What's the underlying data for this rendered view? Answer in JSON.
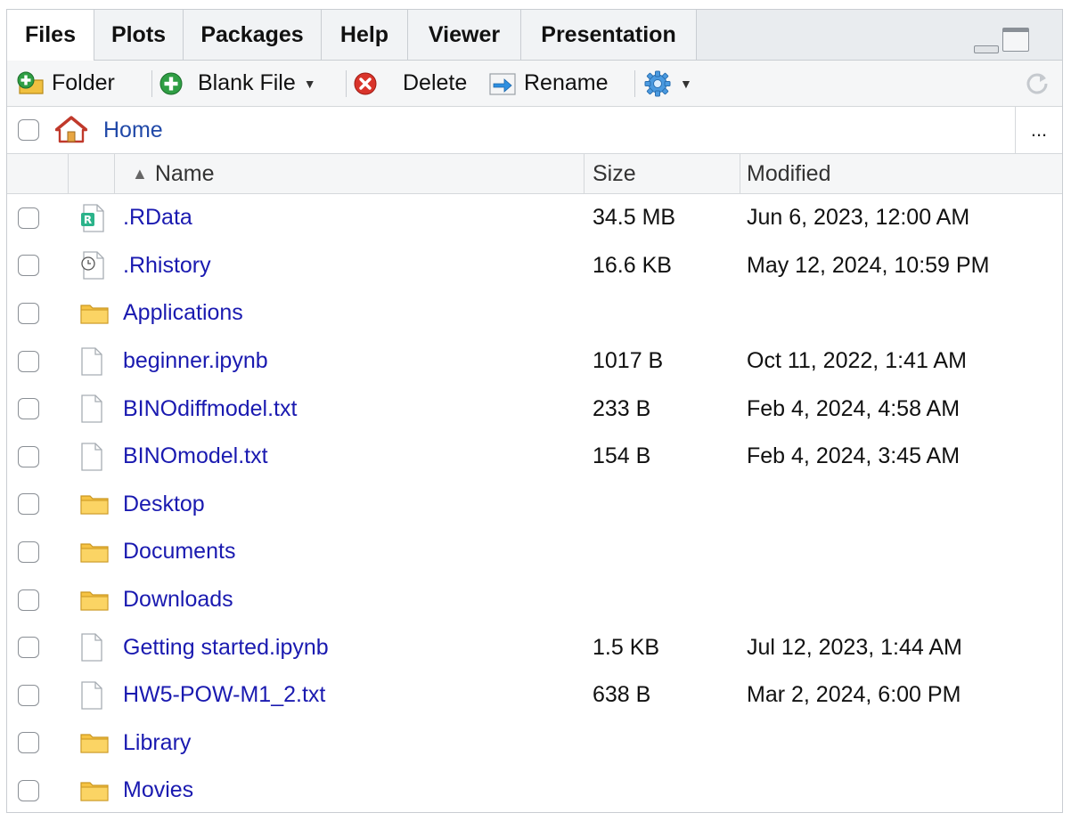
{
  "tabs": [
    {
      "label": "Files",
      "active": true
    },
    {
      "label": "Plots"
    },
    {
      "label": "Packages"
    },
    {
      "label": "Help"
    },
    {
      "label": "Viewer"
    },
    {
      "label": "Presentation"
    }
  ],
  "toolbar": {
    "folder_label": "Folder",
    "blank_file_label": "Blank File",
    "delete_label": "Delete",
    "rename_label": "Rename"
  },
  "breadcrumb": {
    "home_label": "Home",
    "more_label": "..."
  },
  "columns": {
    "name": "Name",
    "size": "Size",
    "modified": "Modified",
    "sort_indicator": "▲"
  },
  "files": [
    {
      "name": ".RData",
      "icon": "rdata-file-icon",
      "size": "34.5 MB",
      "modified": "Jun 6, 2023, 12:00 AM"
    },
    {
      "name": ".Rhistory",
      "icon": "history-file-icon",
      "size": "16.6 KB",
      "modified": "May 12, 2024, 10:59 PM"
    },
    {
      "name": "Applications",
      "icon": "folder-icon",
      "size": "",
      "modified": ""
    },
    {
      "name": "beginner.ipynb",
      "icon": "file-icon",
      "size": "1017 B",
      "modified": "Oct 11, 2022, 1:41 AM"
    },
    {
      "name": "BINOdiffmodel.txt",
      "icon": "file-icon",
      "size": "233 B",
      "modified": "Feb 4, 2024, 4:58 AM"
    },
    {
      "name": "BINOmodel.txt",
      "icon": "file-icon",
      "size": "154 B",
      "modified": "Feb 4, 2024, 3:45 AM"
    },
    {
      "name": "Desktop",
      "icon": "folder-icon",
      "size": "",
      "modified": ""
    },
    {
      "name": "Documents",
      "icon": "folder-icon",
      "size": "",
      "modified": ""
    },
    {
      "name": "Downloads",
      "icon": "folder-icon",
      "size": "",
      "modified": ""
    },
    {
      "name": "Getting started.ipynb",
      "icon": "file-icon",
      "size": "1.5 KB",
      "modified": "Jul 12, 2023, 1:44 AM"
    },
    {
      "name": "HW5-POW-M1_2.txt",
      "icon": "file-icon",
      "size": "638 B",
      "modified": "Mar 2, 2024, 6:00 PM"
    },
    {
      "name": "Library",
      "icon": "folder-icon",
      "size": "",
      "modified": ""
    },
    {
      "name": "Movies",
      "icon": "folder-icon",
      "size": "",
      "modified": ""
    }
  ],
  "colors": {
    "link": "#1a1ab0",
    "home_link": "#2149a8",
    "tab_bg": "#e9ecef",
    "toolbar_bg": "#f5f6f7"
  }
}
